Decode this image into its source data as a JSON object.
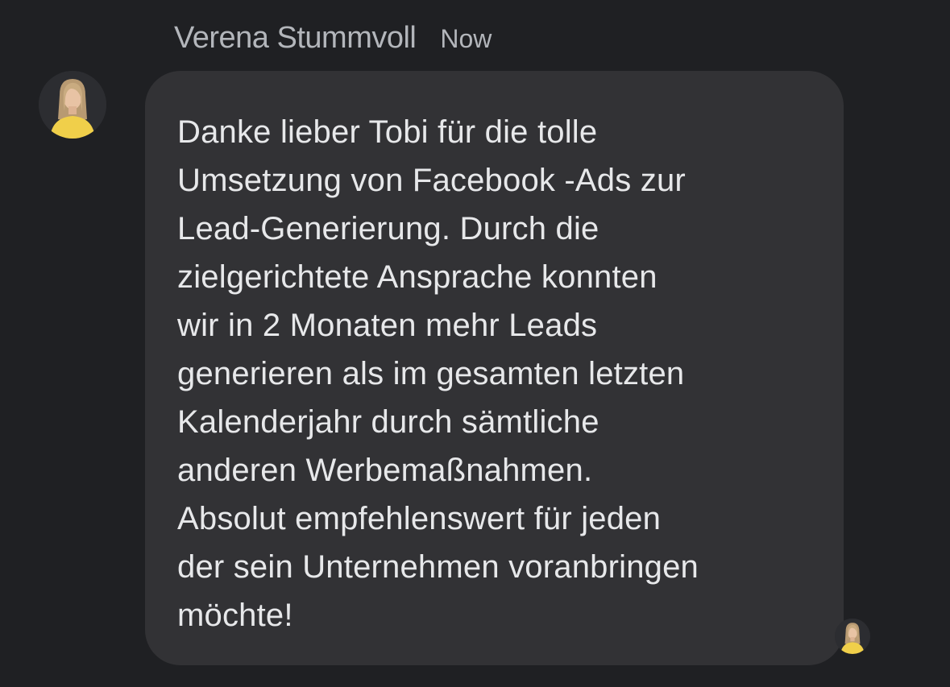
{
  "message": {
    "sender_name": "Verena Stummvoll",
    "timestamp": "Now",
    "text": "Danke lieber Tobi für die tolle\nUmsetzung von Facebook -Ads zur\nLead-Generierung. Durch die\nzielgerichtete Ansprache konnten\nwir in 2 Monaten mehr Leads\ngenerieren als im gesamten letzten\nKalenderjahr durch sämtliche\nanderen Werbemaßnahmen.\nAbsolut empfehlenswert für jeden\nder sein Unternehmen voranbringen\nmöchte!"
  },
  "avatar": {
    "icon": "profile-photo-woman-yellow-shirt"
  },
  "read_receipt": {
    "icon": "read-receipt-avatar"
  },
  "colors": {
    "background": "#1f2023",
    "bubble": "#323235",
    "text": "#e7e8ea",
    "secondary_text": "#b3b6bb"
  }
}
